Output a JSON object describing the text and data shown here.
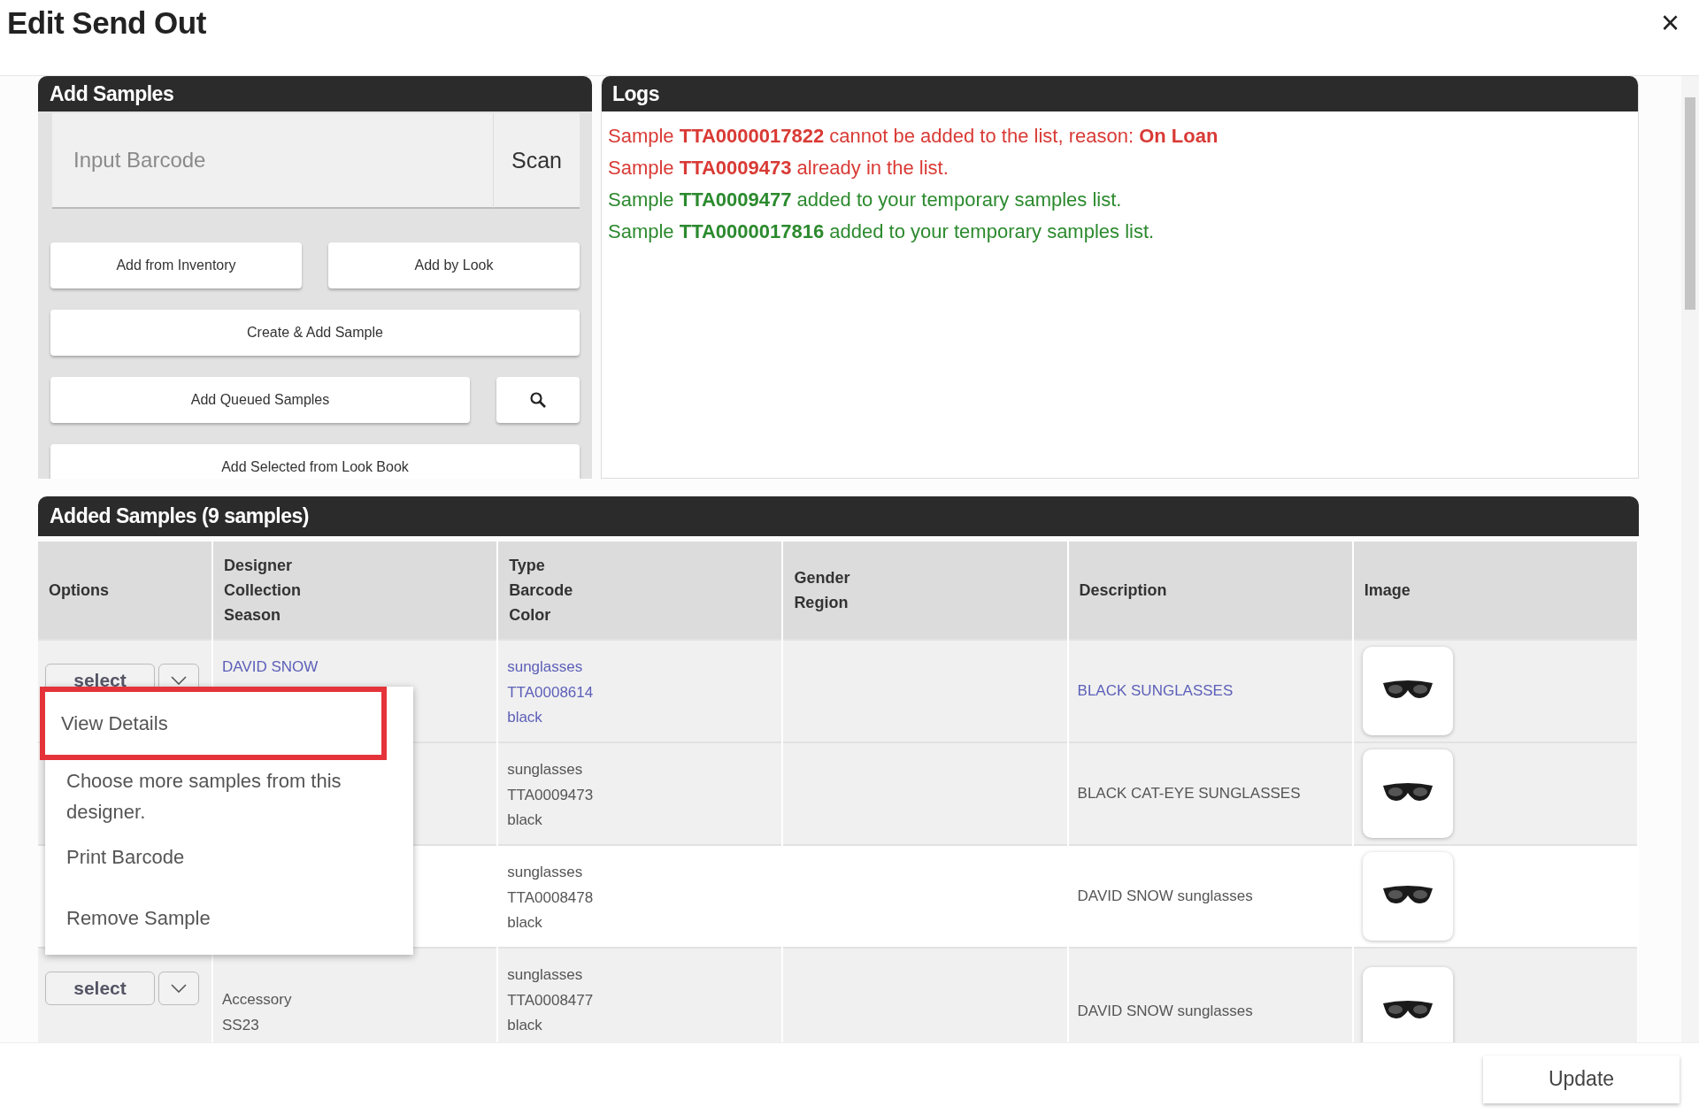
{
  "dialog": {
    "title": "Edit Send Out",
    "close": "×"
  },
  "add_samples": {
    "title": "Add Samples",
    "barcode": {
      "placeholder": "Input Barcode"
    },
    "scan": "Scan",
    "buttons": [
      {
        "label": "Add from Inventory",
        "kind": "half"
      },
      {
        "label": "Add by Look",
        "kind": "half"
      },
      {
        "label": "Create & Add Sample",
        "kind": "full"
      },
      {
        "label": "Add Queued Samples",
        "kind": "with-search"
      },
      {
        "label": "Add Selected from Look Book",
        "kind": "full"
      }
    ]
  },
  "logs": {
    "title": "Logs",
    "entries": [
      {
        "text": "Sample **TTA0000017822** cannot be added to the list, reason: **On Loan**",
        "kind": "error"
      },
      {
        "text": "Sample **TTA0009473** already in the list.",
        "kind": "error"
      },
      {
        "text": "Sample **TTA0009477** added to your temporary samples list.",
        "kind": "success"
      },
      {
        "text": "Sample **TTA0000017816** added to your temporary samples list.",
        "kind": "success"
      }
    ]
  },
  "samples": {
    "title": "Added Samples (9 samples)",
    "columns": [
      [
        "Options"
      ],
      [
        "Designer",
        "Collection",
        "Season"
      ],
      [
        "Type",
        "Barcode",
        "Color"
      ],
      [
        "Gender",
        "Region"
      ],
      [
        "Description"
      ],
      [
        "Image"
      ]
    ],
    "rows": [
      {
        "select": "select",
        "selected": true,
        "shaded": true,
        "designer": [
          "DAVID SNOW"
        ],
        "type": [
          "sunglasses",
          "TTA0008614",
          "black"
        ],
        "description": "BLACK SUNGLASSES"
      },
      {
        "selected": false,
        "shaded": true,
        "type": [
          "sunglasses",
          "TTA0009473",
          "black"
        ],
        "description": "BLACK CAT-EYE SUNGLASSES"
      },
      {
        "selected": false,
        "shaded": false,
        "type": [
          "sunglasses",
          "TTA0008478",
          "black"
        ],
        "description": "DAVID SNOW sunglasses"
      },
      {
        "select": "select",
        "selected": false,
        "shaded": true,
        "designer": [
          "Accessory",
          "SS23"
        ],
        "type": [
          "sunglasses",
          "TTA0008477",
          "black"
        ],
        "description": "DAVID SNOW sunglasses"
      }
    ],
    "menu": {
      "items": [
        {
          "label": "View Details",
          "selected": true
        },
        {
          "label": "Choose more samples from this designer.",
          "selected": false
        },
        {
          "label": "Print Barcode",
          "selected": false
        },
        {
          "label": "Remove Sample",
          "selected": false
        }
      ]
    }
  },
  "footer": {
    "update": "Update"
  }
}
